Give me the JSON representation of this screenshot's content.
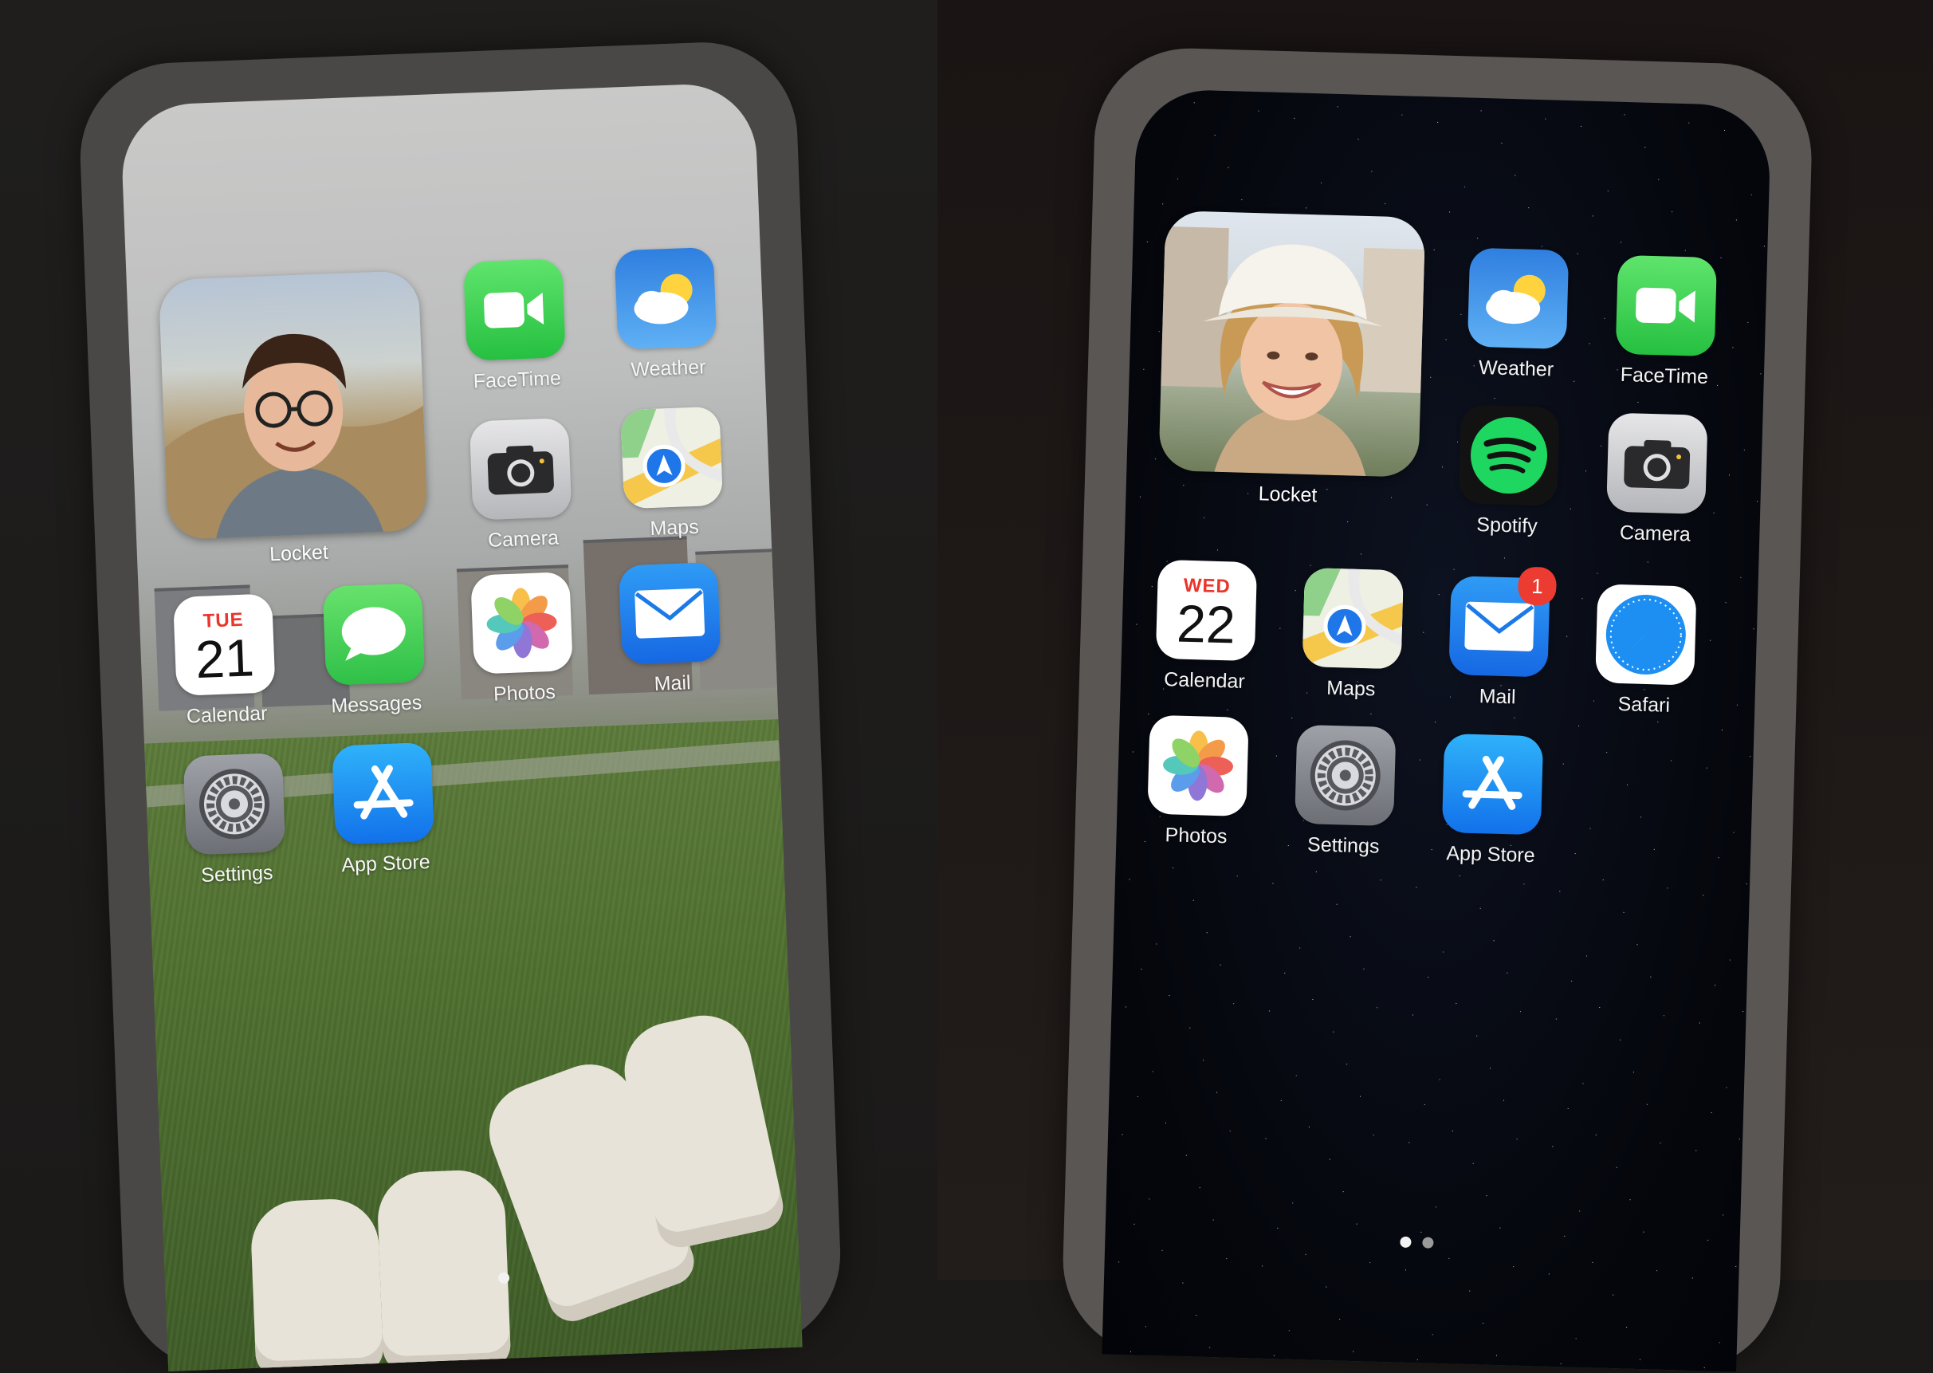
{
  "left_screen": {
    "widget": {
      "label": "Locket",
      "subject": "man with glasses, hills background"
    },
    "apps": [
      {
        "label": "FaceTime",
        "icon": "facetime-icon"
      },
      {
        "label": "Weather",
        "icon": "weather-icon"
      },
      {
        "label": "Camera",
        "icon": "camera-icon"
      },
      {
        "label": "Maps",
        "icon": "maps-icon"
      },
      {
        "label": "Calendar",
        "icon": "calendar-icon",
        "day": "TUE",
        "date": "21"
      },
      {
        "label": "Messages",
        "icon": "messages-icon"
      },
      {
        "label": "Photos",
        "icon": "photos-icon"
      },
      {
        "label": "Mail",
        "icon": "mail-icon"
      },
      {
        "label": "Settings",
        "icon": "settings-icon"
      },
      {
        "label": "App Store",
        "icon": "app-store-icon"
      }
    ],
    "page_dots": {
      "count": 1,
      "active": 0
    }
  },
  "right_screen": {
    "widget": {
      "label": "Locket",
      "subject": "woman in white bucket hat smiling"
    },
    "apps": [
      {
        "label": "Weather",
        "icon": "weather-icon"
      },
      {
        "label": "FaceTime",
        "icon": "facetime-icon"
      },
      {
        "label": "Spotify",
        "icon": "spotify-icon"
      },
      {
        "label": "Camera",
        "icon": "camera-icon"
      },
      {
        "label": "Calendar",
        "icon": "calendar-icon",
        "day": "WED",
        "date": "22"
      },
      {
        "label": "Maps",
        "icon": "maps-icon"
      },
      {
        "label": "Mail",
        "icon": "mail-icon",
        "badge": "1"
      },
      {
        "label": "Safari",
        "icon": "safari-icon"
      },
      {
        "label": "Photos",
        "icon": "photos-icon"
      },
      {
        "label": "Settings",
        "icon": "settings-icon"
      },
      {
        "label": "App Store",
        "icon": "app-store-icon"
      }
    ],
    "page_dots": {
      "count": 2,
      "active": 0
    }
  },
  "colors": {
    "badge_red": "#ec3b30",
    "calendar_red": "#e9352b",
    "facetime_green": "#26c041",
    "mail_blue": "#1668e3",
    "spotify_green": "#1ed760"
  }
}
